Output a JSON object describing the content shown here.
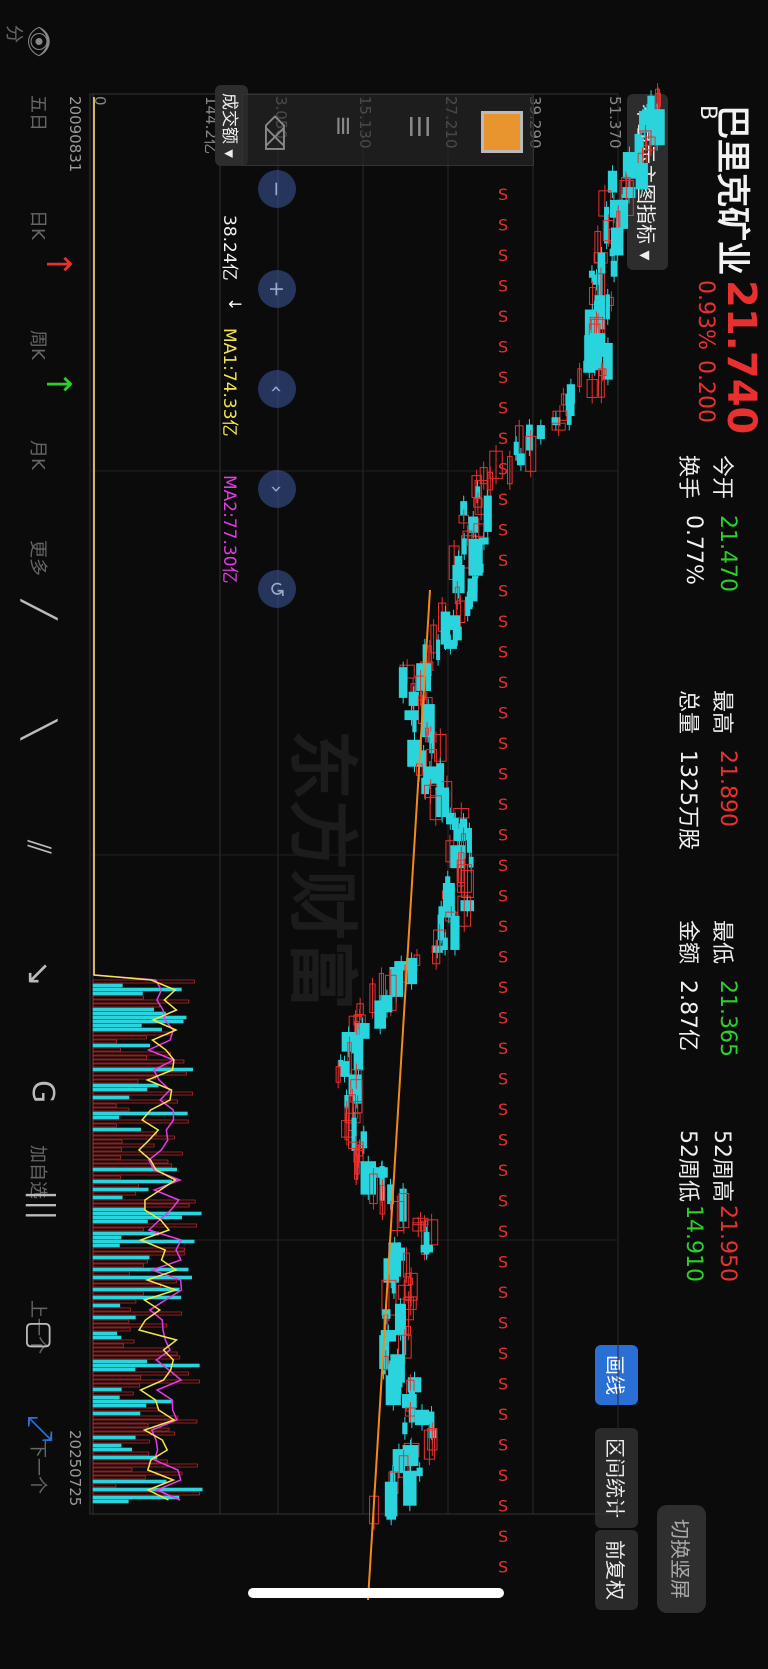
{
  "header": {
    "name": "巴里克矿业",
    "price": "21.740",
    "market": "B",
    "change_pct": "0.93%",
    "change": "0.200",
    "stats": [
      {
        "label": "今开",
        "value": "21.470",
        "color": "green"
      },
      {
        "label": "最高",
        "value": "21.890",
        "color": "red"
      },
      {
        "label": "最低",
        "value": "21.365",
        "color": "green"
      },
      {
        "label": "52周高",
        "value": "21.950",
        "color": "red"
      },
      {
        "label": "换手",
        "value": "0.77%",
        "color": "white"
      },
      {
        "label": "总量",
        "value": "1325万股",
        "color": "white"
      },
      {
        "label": "金额",
        "value": "2.87亿",
        "color": "white"
      },
      {
        "label": "52周低",
        "value": "14.910",
        "color": "green"
      }
    ],
    "indicator_toggle": "不显示主图指标",
    "switch_button": "切换竖屏",
    "draw_button": "画线",
    "interval_button": "区间统计",
    "adjust_button": "前复权"
  },
  "chart": {
    "y_labels": [
      "51.370",
      "39.290",
      "27.210",
      "15.130",
      "3.050"
    ],
    "watermark": "东方财富",
    "volume_label": "成交额",
    "volume_value": "38.24亿",
    "volume_max": "144.2亿",
    "volume_zero": "0",
    "ma1": "MA1:74.33亿",
    "ma2": "MA2:77.30亿",
    "date_start": "20090831",
    "date_end": "20250725",
    "signal_letter": "S",
    "colors": {
      "up": "#e8312f",
      "down": "#2ad4dc",
      "ma1": "#f2e64a",
      "ma2": "#e43be6",
      "trend": "#f28a1c"
    }
  },
  "toolbar": {
    "periods": [
      "分",
      "五日",
      "日K",
      "周K",
      "月K",
      "更多"
    ],
    "tools": [
      "加自选",
      "上一个",
      "下一个"
    ]
  }
}
